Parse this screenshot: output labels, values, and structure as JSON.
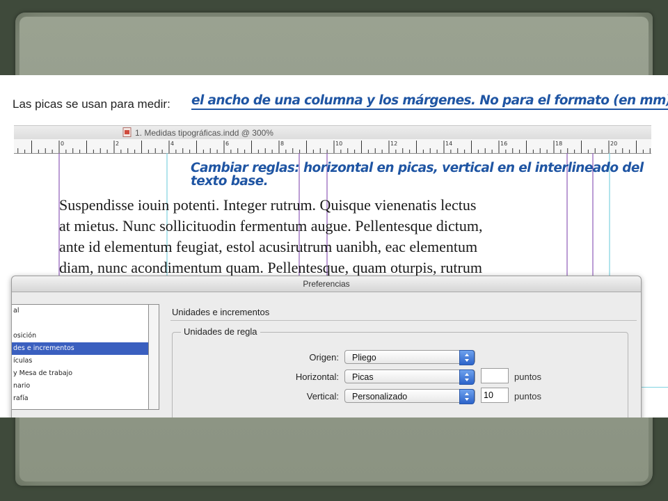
{
  "heading": {
    "label": "Las picas se usan para medir:",
    "note": "el ancho de una columna y los márgenes. No para el formato (en mm)"
  },
  "document": {
    "title": "1. Medidas tipográficas.indd @ 300%",
    "ruler_labels": [
      "0",
      "2",
      "4",
      "6",
      "8",
      "10",
      "12",
      "14",
      "16",
      "18",
      "20"
    ]
  },
  "note2": {
    "line1": "Cambiar reglas: horizontal en picas, vertical en el interlineado del",
    "line2": "texto base."
  },
  "body_text": [
    "Suspendisse iouin potenti. Integer rutrum. Quisque vienenatis lectus",
    "at mietus. Nunc sollicituodin fermentum augue. Pellentesque dictum,",
    "ante id elementum feugiat, estol  acusirutrum uanibh, eac elementum",
    "diam, nunc acondimentum quam. Pellentesque, quam oturpis, rutrum"
  ],
  "dialog": {
    "title": "Preferencias",
    "sidebar": [
      {
        "label": "al",
        "selected": false
      },
      {
        "label": "",
        "selected": false
      },
      {
        "label": "osición",
        "selected": false
      },
      {
        "label": "des e incrementos",
        "selected": true
      },
      {
        "label": "ículas",
        "selected": false
      },
      {
        "label": "y Mesa de trabajo",
        "selected": false
      },
      {
        "label": "nario",
        "selected": false
      },
      {
        "label": "rafía",
        "selected": false
      }
    ],
    "pane_title": "Unidades e incrementos",
    "group_label": "Unidades de regla",
    "rows": [
      {
        "label": "Origen:",
        "value": "Pliego",
        "field": null,
        "unit": null
      },
      {
        "label": "Horizontal:",
        "value": "Picas",
        "field": "",
        "unit": "puntos"
      },
      {
        "label": "Vertical:",
        "value": "Personalizado",
        "field": "10",
        "unit": "puntos"
      }
    ]
  },
  "colors": {
    "note_blue": "#1f55a3",
    "guide_purple": "#8e5bb8",
    "guide_cyan": "#7fd3e0",
    "selection_blue": "#3a5fbf"
  }
}
